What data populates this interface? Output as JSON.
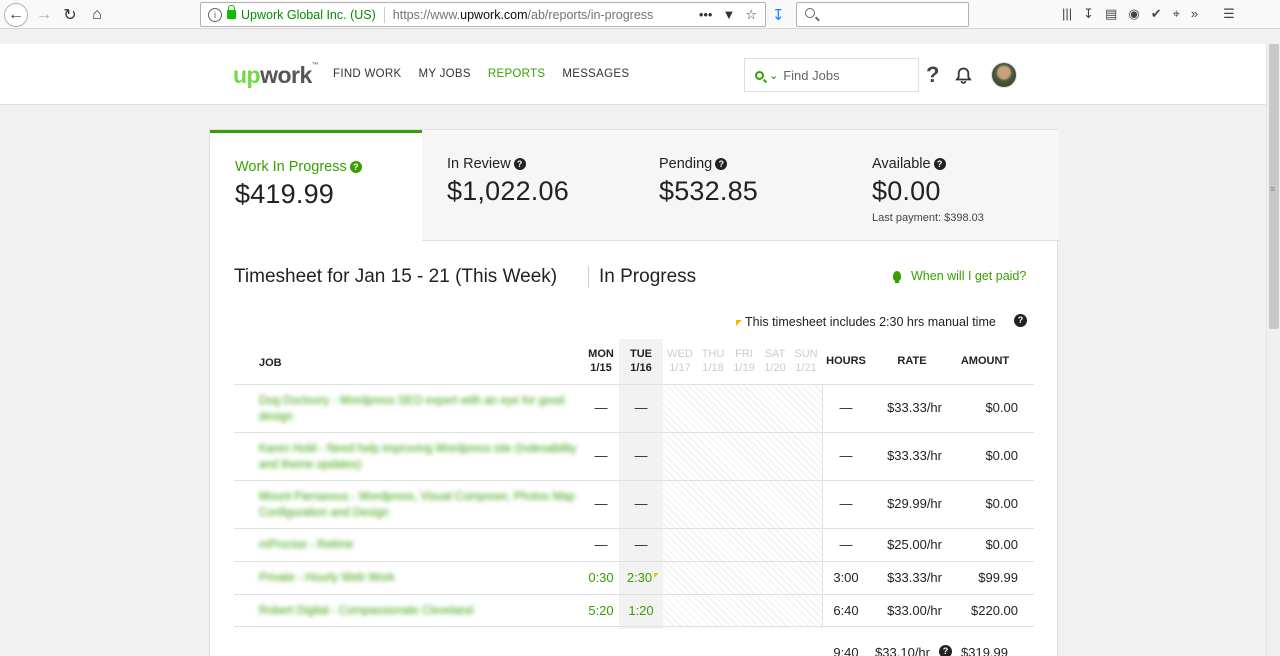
{
  "browser": {
    "url_identity": "Upwork Global Inc. (US)",
    "url_prefix": "https://www.",
    "url_domain": "upwork.com",
    "url_path": "/ab/reports/in-progress",
    "search_placeholder": ""
  },
  "header": {
    "logo_up": "up",
    "logo_work": "work",
    "nav": [
      "FIND WORK",
      "MY JOBS",
      "REPORTS",
      "MESSAGES"
    ],
    "active_nav": "REPORTS",
    "find_jobs_placeholder": "Find Jobs",
    "help_glyph": "?"
  },
  "stats": [
    {
      "label": "Work In Progress",
      "value": "$419.99",
      "active": true
    },
    {
      "label": "In Review",
      "value": "$1,022.06"
    },
    {
      "label": "Pending",
      "value": "$532.85"
    },
    {
      "label": "Available",
      "value": "$0.00",
      "sub": "Last payment: $398.03"
    }
  ],
  "timesheet": {
    "title": "Timesheet for Jan 15 - 21 (This Week)",
    "status": "In Progress",
    "paid_link": "When will I get paid?",
    "manual_note": "This timesheet includes 2:30 hrs manual time",
    "columns": {
      "job": "JOB",
      "days": [
        {
          "day": "MON",
          "date": "1/15"
        },
        {
          "day": "TUE",
          "date": "1/16"
        },
        {
          "day": "WED",
          "date": "1/17"
        },
        {
          "day": "THU",
          "date": "1/18"
        },
        {
          "day": "FRI",
          "date": "1/19"
        },
        {
          "day": "SAT",
          "date": "1/20"
        },
        {
          "day": "SUN",
          "date": "1/21"
        }
      ],
      "hours": "HOURS",
      "rate": "RATE",
      "amount": "AMOUNT"
    },
    "rows": [
      {
        "job": "Dog Doctoory - Wordpress SEO expert with an eye for good design",
        "mon": "—",
        "tue": "—",
        "hours": "—",
        "rate": "$33.33/hr",
        "amount": "$0.00"
      },
      {
        "job": "Karen Hold - Need help improving Wordpress site (Indexability and theme updates)",
        "mon": "—",
        "tue": "—",
        "hours": "—",
        "rate": "$33.33/hr",
        "amount": "$0.00"
      },
      {
        "job": "Mount Parnassus - Wordpress, Visual Composer, Photos Map Configuration and Design",
        "mon": "—",
        "tue": "—",
        "hours": "—",
        "rate": "$29.99/hr",
        "amount": "$0.00"
      },
      {
        "job": "mProcise - Retime",
        "mon": "—",
        "tue": "—",
        "hours": "—",
        "rate": "$25.00/hr",
        "amount": "$0.00"
      },
      {
        "job": "Private - Hourly Web Work",
        "mon": "0:30",
        "tue": "2:30",
        "tue_manual": true,
        "hours": "3:00",
        "rate": "$33.33/hr",
        "amount": "$99.99"
      },
      {
        "job": "Robert Digital - Compassionate Cleveland",
        "mon": "5:20",
        "tue": "1:20",
        "hours": "6:40",
        "rate": "$33.00/hr",
        "amount": "$220.00"
      }
    ],
    "total": {
      "hours": "9:40",
      "rate": "$33.10/hr",
      "amount": "$319.99"
    }
  }
}
